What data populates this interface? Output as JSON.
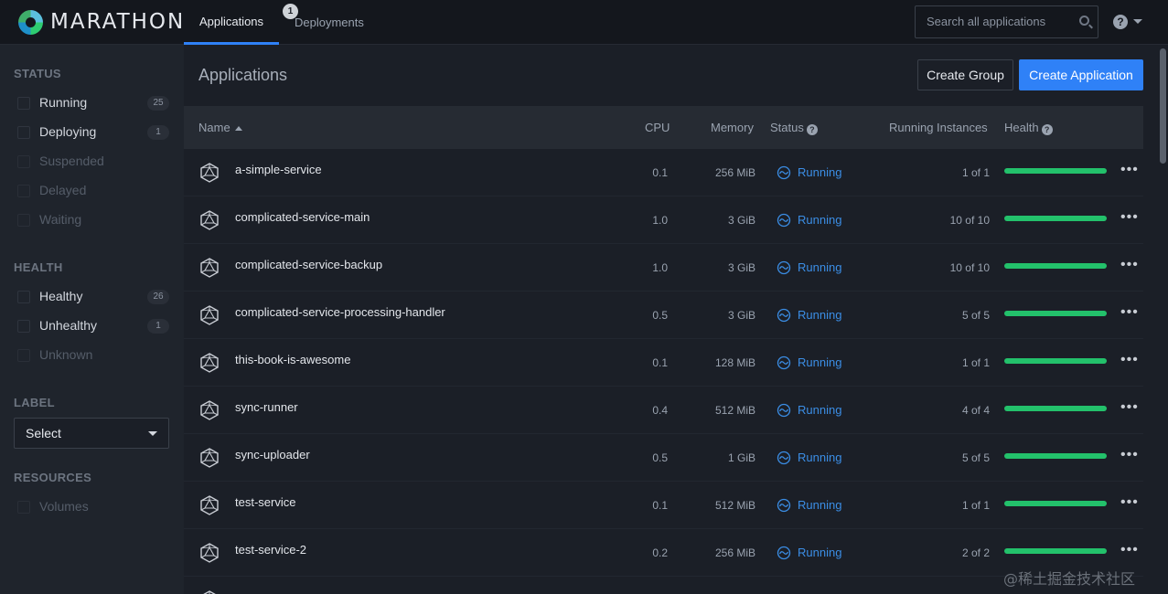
{
  "brand": {
    "name": "MARATHON"
  },
  "nav": {
    "tabs": [
      {
        "label": "Applications",
        "active": true
      },
      {
        "label": "Deployments",
        "badge": "1"
      }
    ],
    "search_placeholder": "Search all applications",
    "help_glyph": "?"
  },
  "sidebar": {
    "status_heading": "STATUS",
    "status_items": [
      {
        "label": "Running",
        "count": "25"
      },
      {
        "label": "Deploying",
        "count": "1"
      },
      {
        "label": "Suspended"
      },
      {
        "label": "Delayed"
      },
      {
        "label": "Waiting"
      }
    ],
    "health_heading": "HEALTH",
    "health_items": [
      {
        "label": "Healthy",
        "count": "26"
      },
      {
        "label": "Unhealthy",
        "count": "1"
      },
      {
        "label": "Unknown"
      }
    ],
    "label_heading": "LABEL",
    "label_select": "Select",
    "resources_heading": "RESOURCES",
    "resources_items": [
      {
        "label": "Volumes"
      }
    ]
  },
  "main": {
    "title": "Applications",
    "create_group_label": "Create Group",
    "create_app_label": "Create Application",
    "columns": {
      "name": "Name",
      "cpu": "CPU",
      "memory": "Memory",
      "status": "Status",
      "instances": "Running Instances",
      "health": "Health"
    },
    "apps": [
      {
        "name": "a-simple-service",
        "cpu": "0.1",
        "memory": "256 MiB",
        "status": "Running",
        "instances": "1 of 1",
        "health": 1.0
      },
      {
        "name": "complicated-service-main",
        "cpu": "1.0",
        "memory": "3 GiB",
        "status": "Running",
        "instances": "10 of 10",
        "health": 1.0
      },
      {
        "name": "complicated-service-backup",
        "cpu": "1.0",
        "memory": "3 GiB",
        "status": "Running",
        "instances": "10 of 10",
        "health": 1.0
      },
      {
        "name": "complicated-service-processing-handler",
        "cpu": "0.5",
        "memory": "3 GiB",
        "status": "Running",
        "instances": "5 of 5",
        "health": 1.0
      },
      {
        "name": "this-book-is-awesome",
        "cpu": "0.1",
        "memory": "128 MiB",
        "status": "Running",
        "instances": "1 of 1",
        "health": 1.0
      },
      {
        "name": "sync-runner",
        "cpu": "0.4",
        "memory": "512 MiB",
        "status": "Running",
        "instances": "4 of 4",
        "health": 1.0
      },
      {
        "name": "sync-uploader",
        "cpu": "0.5",
        "memory": "1 GiB",
        "status": "Running",
        "instances": "5 of 5",
        "health": 1.0
      },
      {
        "name": "test-service",
        "cpu": "0.1",
        "memory": "512 MiB",
        "status": "Running",
        "instances": "1 of 1",
        "health": 1.0
      },
      {
        "name": "test-service-2",
        "cpu": "0.2",
        "memory": "256 MiB",
        "status": "Running",
        "instances": "2 of 2",
        "health": 1.0
      }
    ],
    "row_menu_glyph": "•••"
  },
  "watermark": "@稀土掘金技术社区",
  "colors": {
    "accent": "#2f81f7",
    "status_running": "#3b8ee6",
    "health_bar": "#23c16b"
  }
}
